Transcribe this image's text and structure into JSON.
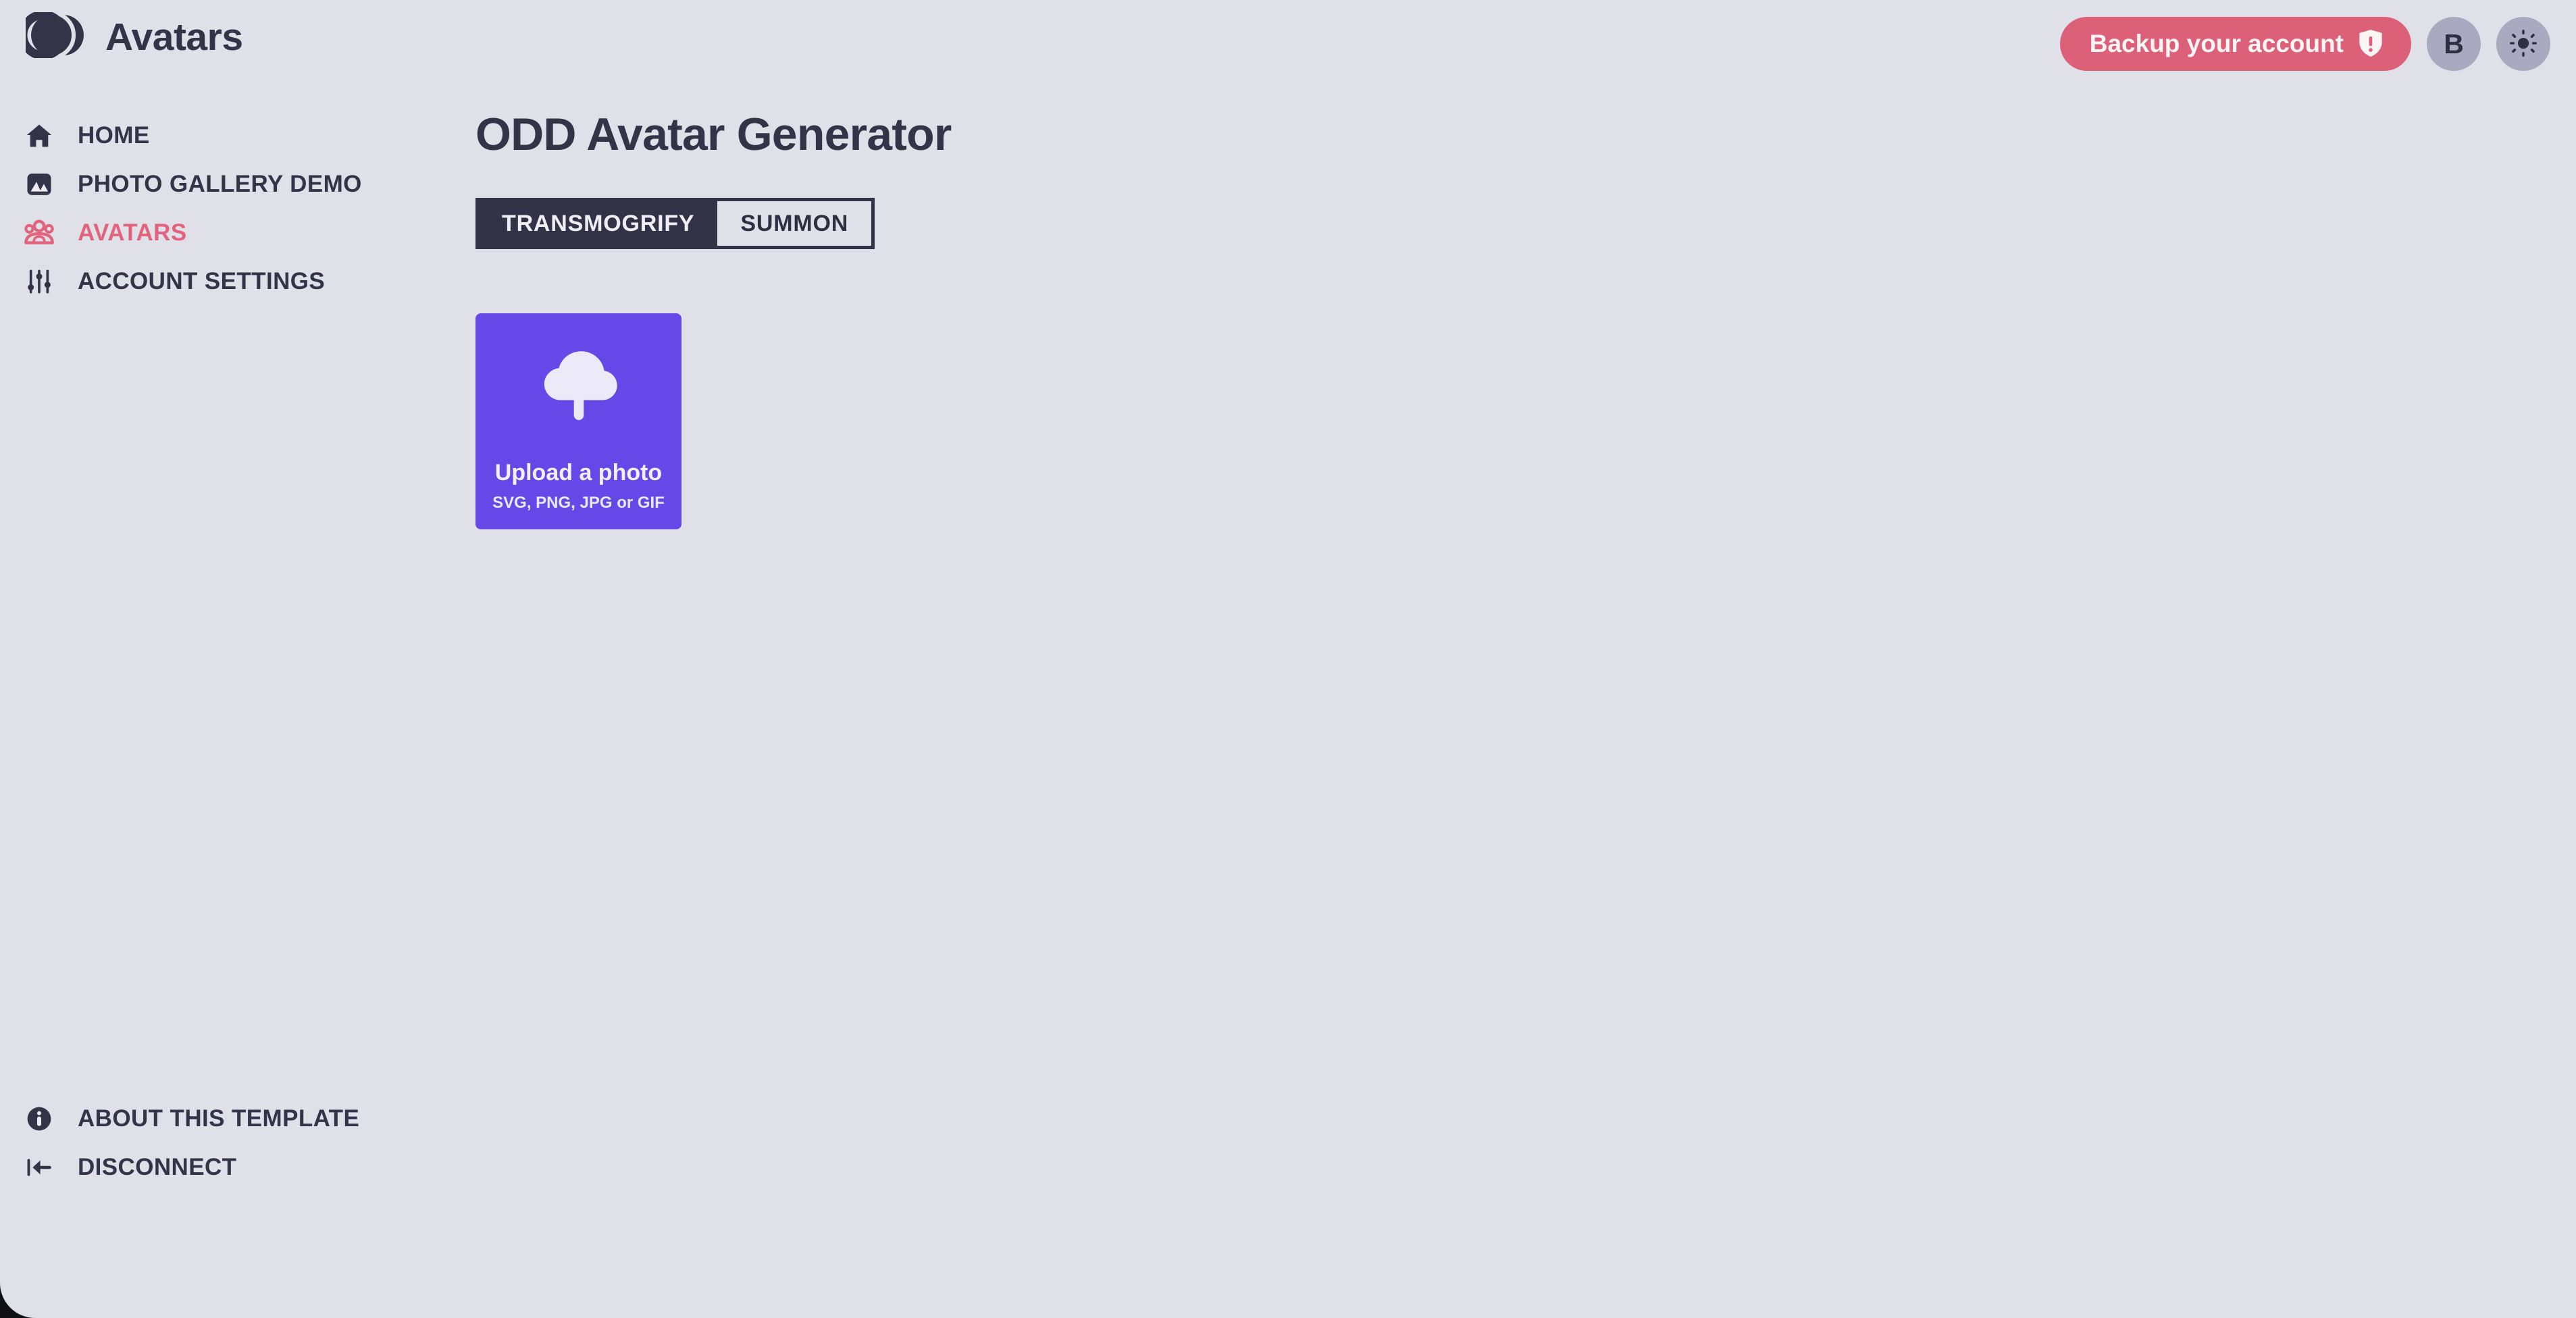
{
  "theme": {
    "page_bg": "#e0e0e9",
    "ink": "#343449",
    "accent_pink": "#dd6079",
    "accent_purple": "#6449e8",
    "dark_panel": "#333347",
    "avatar_bg": "#a9aabf"
  },
  "header": {
    "logo_icon": "three-overlapping-circles-logo",
    "title": "Avatars",
    "backup_button": {
      "label": "Backup your account",
      "icon": "shield-exclamation-icon"
    },
    "account_avatar": {
      "initial": "B",
      "name": "account-avatar"
    },
    "theme_toggle": {
      "icon": "sun-icon"
    }
  },
  "sidebar": {
    "items": [
      {
        "label": "HOME",
        "icon": "home-icon",
        "active": false
      },
      {
        "label": "PHOTO GALLERY DEMO",
        "icon": "image-icon",
        "active": false
      },
      {
        "label": "AVATARS",
        "icon": "group-users-icon",
        "active": true
      },
      {
        "label": "ACCOUNT SETTINGS",
        "icon": "sliders-icon",
        "active": false
      }
    ],
    "footer_items": [
      {
        "label": "ABOUT THIS TEMPLATE",
        "icon": "info-circle-icon"
      },
      {
        "label": "DISCONNECT",
        "icon": "logout-icon"
      }
    ]
  },
  "main": {
    "title": "ODD Avatar Generator",
    "tabs": [
      {
        "label": "TRANSMOGRIFY",
        "active": true
      },
      {
        "label": "SUMMON",
        "active": false
      }
    ],
    "upload": {
      "icon": "cloud-upload-icon",
      "title": "Upload a photo",
      "subtitle": "SVG, PNG, JPG or GIF"
    }
  }
}
